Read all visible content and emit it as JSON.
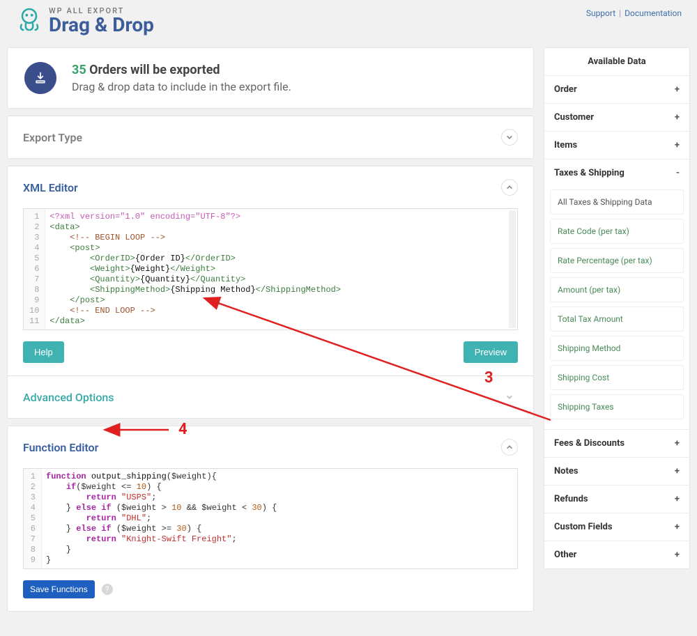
{
  "header": {
    "super": "WP ALL EXPORT",
    "title": "Drag & Drop",
    "links": {
      "support": "Support",
      "documentation": "Documentation"
    }
  },
  "info": {
    "count": "35",
    "title_rest": "Orders will be exported",
    "subtitle": "Drag & drop data to include in the export file."
  },
  "sections": {
    "export_type": "Export Type",
    "xml_editor": "XML Editor",
    "advanced_options": "Advanced Options",
    "function_editor": "Function Editor"
  },
  "buttons": {
    "help": "Help",
    "preview": "Preview",
    "save_functions": "Save Functions"
  },
  "xml_lines": [
    {
      "n": 1,
      "html": "<span class='s-decl'>&lt;?xml version=\"1.0\" encoding=\"UTF-8\"?&gt;</span>"
    },
    {
      "n": 2,
      "html": "<span class='s-tag'>&lt;data&gt;</span>"
    },
    {
      "n": 3,
      "html": "    <span class='s-comment'>&lt;!-- BEGIN LOOP --&gt;</span>"
    },
    {
      "n": 4,
      "html": "    <span class='s-tag'>&lt;post&gt;</span>"
    },
    {
      "n": 5,
      "html": "        <span class='s-tag'>&lt;OrderID&gt;</span><span class='s-text'>{Order ID}</span><span class='s-tag'>&lt;/OrderID&gt;</span>"
    },
    {
      "n": 6,
      "html": "        <span class='s-tag'>&lt;Weight&gt;</span><span class='s-text'>{Weight}</span><span class='s-tag'>&lt;/Weight&gt;</span>"
    },
    {
      "n": 7,
      "html": "        <span class='s-tag'>&lt;Quantity&gt;</span><span class='s-text'>{Quantity}</span><span class='s-tag'>&lt;/Quantity&gt;</span>"
    },
    {
      "n": 8,
      "html": "        <span class='s-tag'>&lt;ShippingMethod&gt;</span><span class='s-text'>{Shipping Method}</span><span class='s-tag'>&lt;/ShippingMethod&gt;</span>"
    },
    {
      "n": 9,
      "html": "    <span class='s-tag'>&lt;/post&gt;</span>"
    },
    {
      "n": 10,
      "html": "    <span class='s-comment'>&lt;!-- END LOOP --&gt;</span>"
    },
    {
      "n": 11,
      "html": "<span class='s-tag'>&lt;/data&gt;</span>"
    }
  ],
  "fn_lines": [
    {
      "n": 1,
      "html": "<span class='s-kw'>function</span> <span class='s-fn'>output_shipping</span>(<span class='s-var'>$weight</span>){"
    },
    {
      "n": 2,
      "html": "    <span class='s-kw'>if</span>(<span class='s-var'>$weight</span> <span class='s-op'>&lt;=</span> <span class='s-num'>10</span>) {"
    },
    {
      "n": 3,
      "html": "        <span class='s-kw'>return</span> <span class='s-str'>\"USPS\"</span>;"
    },
    {
      "n": 4,
      "html": "    } <span class='s-kw'>else if</span> (<span class='s-var'>$weight</span> <span class='s-op'>&gt;</span> <span class='s-num'>10</span> <span class='s-op'>&amp;&amp;</span> <span class='s-var'>$weight</span> <span class='s-op'>&lt;</span> <span class='s-num'>30</span>) {"
    },
    {
      "n": 5,
      "html": "        <span class='s-kw'>return</span> <span class='s-str'>\"DHL\"</span>;"
    },
    {
      "n": 6,
      "html": "    } <span class='s-kw'>else if</span> (<span class='s-var'>$weight</span> <span class='s-op'>&gt;=</span> <span class='s-num'>30</span>) {"
    },
    {
      "n": 7,
      "html": "        <span class='s-kw'>return</span> <span class='s-str'>\"Knight-Swift Freight\"</span>;"
    },
    {
      "n": 8,
      "html": "    }"
    },
    {
      "n": 9,
      "html": "}"
    }
  ],
  "sidebar": {
    "title": "Available Data",
    "groups": [
      {
        "label": "Order",
        "expanded": false
      },
      {
        "label": "Customer",
        "expanded": false
      },
      {
        "label": "Items",
        "expanded": false
      },
      {
        "label": "Taxes & Shipping",
        "expanded": true
      },
      {
        "label": "Fees & Discounts",
        "expanded": false
      },
      {
        "label": "Notes",
        "expanded": false
      },
      {
        "label": "Refunds",
        "expanded": false
      },
      {
        "label": "Custom Fields",
        "expanded": false
      },
      {
        "label": "Other",
        "expanded": false
      }
    ],
    "taxes_shipping_fields": [
      {
        "label": "All Taxes & Shipping Data",
        "plain": true
      },
      {
        "label": "Rate Code (per tax)"
      },
      {
        "label": "Rate Percentage (per tax)"
      },
      {
        "label": "Amount (per tax)"
      },
      {
        "label": "Total Tax Amount"
      },
      {
        "label": "Shipping Method"
      },
      {
        "label": "Shipping Cost"
      },
      {
        "label": "Shipping Taxes"
      }
    ]
  },
  "annotations": {
    "num3": "3",
    "num4": "4"
  }
}
